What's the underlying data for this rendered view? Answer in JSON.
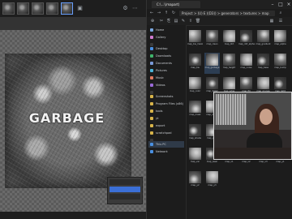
{
  "editor": {
    "overlay_text": "GARBAGE",
    "layers": [
      "",
      "",
      ""
    ],
    "status_items": [
      "",
      "",
      "",
      ""
    ]
  },
  "explorer": {
    "tab_title": "C:\\...\\(mapart)",
    "address": "Project > (U) E ((D3)) > generators > textures > map",
    "sidebar": [
      {
        "label": "Home",
        "color": "#7aa7e0"
      },
      {
        "label": "Gallery",
        "color": "#d07ad0"
      },
      {
        "label": "",
        "color": "#3a3a3a"
      },
      {
        "label": "Desktop",
        "color": "#4a90e2"
      },
      {
        "label": "Downloads",
        "color": "#3fb36b"
      },
      {
        "label": "Documents",
        "color": "#7a9ad8"
      },
      {
        "label": "Pictures",
        "color": "#4ab3d8"
      },
      {
        "label": "Music",
        "color": "#e07a5f"
      },
      {
        "label": "Videos",
        "color": "#9a6ad8"
      },
      {
        "label": "",
        "color": "#3a3a3a"
      },
      {
        "label": "Screenshots",
        "color": "#d8b44a"
      },
      {
        "label": "Program Files (x86)",
        "color": "#d8b44a"
      },
      {
        "label": "tools",
        "color": "#d8b44a"
      },
      {
        "label": "yt",
        "color": "#d8b44a"
      },
      {
        "label": "export",
        "color": "#d8b44a"
      },
      {
        "label": "scratchpad",
        "color": "#d8b44a"
      },
      {
        "label": "",
        "color": "#3a3a3a"
      },
      {
        "label": "This PC",
        "color": "#4a90e2"
      },
      {
        "label": "Network",
        "color": "#4a90e2"
      }
    ],
    "files": [
      "map_bw_mask",
      "map_clean",
      "map_dirt",
      "map_dirt_alpha",
      "map_gradient",
      "map_alpha",
      "map_bw",
      "map_garbage",
      "map_height",
      "map_noise",
      "map_base",
      "map_bump",
      "map_color",
      "map_detail",
      "map_edge",
      "map_fill",
      "map_grunge",
      "map_light",
      "map_mask",
      "map_metal",
      "map_norm",
      "map_occl",
      "map_pass",
      "map_rough",
      "map_shade",
      "map_spec",
      "map_tex",
      "map_tile",
      "map_trim",
      "map_util",
      "map_var",
      "map_wear",
      "map_x1",
      "map_x2",
      "map_x3",
      "map_y1",
      "map_y2",
      "map_y3"
    ],
    "selected_file_index": 7,
    "taskbar_items": [
      "",
      ""
    ]
  },
  "theme": {
    "accent": "#3b6fd6",
    "explorer_bg": "#1c1c1c",
    "editor_bg": "#2b2b2b"
  }
}
